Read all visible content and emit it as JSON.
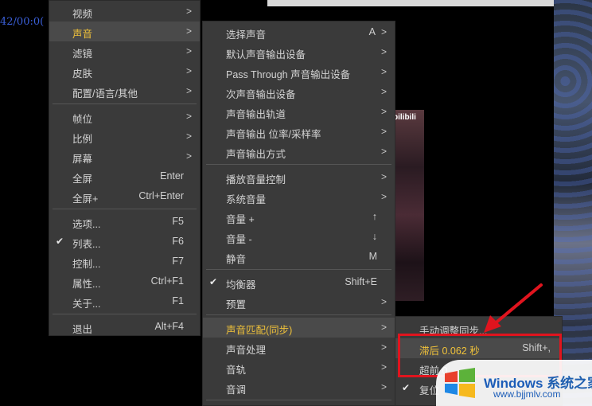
{
  "player": {
    "timecode": "42/00:0("
  },
  "thumbnail_logo": "bilibili",
  "menu1": [
    {
      "label": "视频",
      "shortcut": "",
      "arrow": ">",
      "check": ""
    },
    {
      "label": "声音",
      "shortcut": "",
      "arrow": ">",
      "check": "",
      "highlighted": true
    },
    {
      "label": "滤镜",
      "shortcut": "",
      "arrow": ">",
      "check": ""
    },
    {
      "label": "皮肤",
      "shortcut": "",
      "arrow": ">",
      "check": ""
    },
    {
      "label": "配置/语言/其他",
      "shortcut": "",
      "arrow": ">",
      "check": ""
    },
    {
      "label": "帧位",
      "shortcut": "",
      "arrow": ">",
      "check": ""
    },
    {
      "label": "比例",
      "shortcut": "",
      "arrow": ">",
      "check": ""
    },
    {
      "label": "屏幕",
      "shortcut": "",
      "arrow": ">",
      "check": ""
    },
    {
      "label": "全屏",
      "shortcut": "Enter",
      "arrow": "",
      "check": ""
    },
    {
      "label": "全屏+",
      "shortcut": "Ctrl+Enter",
      "arrow": "",
      "check": ""
    },
    {
      "label": "选项...",
      "shortcut": "F5",
      "arrow": "",
      "check": ""
    },
    {
      "label": "列表...",
      "shortcut": "F6",
      "arrow": "",
      "check": "✔"
    },
    {
      "label": "控制...",
      "shortcut": "F7",
      "arrow": "",
      "check": ""
    },
    {
      "label": "属性...",
      "shortcut": "Ctrl+F1",
      "arrow": "",
      "check": ""
    },
    {
      "label": "关于...",
      "shortcut": "F1",
      "arrow": "",
      "check": ""
    },
    {
      "label": "退出",
      "shortcut": "Alt+F4",
      "arrow": "",
      "check": ""
    }
  ],
  "menu2": [
    {
      "label": "选择声音",
      "shortcut": "A",
      "arrow": ">",
      "check": ""
    },
    {
      "label": "默认声音输出设备",
      "shortcut": "",
      "arrow": ">",
      "check": ""
    },
    {
      "label": "Pass Through 声音输出设备",
      "shortcut": "",
      "arrow": ">",
      "check": ""
    },
    {
      "label": "次声音输出设备",
      "shortcut": "",
      "arrow": ">",
      "check": ""
    },
    {
      "label": "声音输出轨道",
      "shortcut": "",
      "arrow": ">",
      "check": ""
    },
    {
      "label": "声音输出 位率/采样率",
      "shortcut": "",
      "arrow": ">",
      "check": ""
    },
    {
      "label": "声音输出方式",
      "shortcut": "",
      "arrow": ">",
      "check": ""
    },
    {
      "label": "播放音量控制",
      "shortcut": "",
      "arrow": ">",
      "check": ""
    },
    {
      "label": "系统音量",
      "shortcut": "",
      "arrow": ">",
      "check": ""
    },
    {
      "label": "音量 +",
      "shortcut": "↑",
      "arrow": "",
      "check": ""
    },
    {
      "label": "音量 -",
      "shortcut": "↓",
      "arrow": "",
      "check": ""
    },
    {
      "label": "静音",
      "shortcut": "M",
      "arrow": "",
      "check": ""
    },
    {
      "label": "均衡器",
      "shortcut": "Shift+E",
      "arrow": "",
      "check": "✔"
    },
    {
      "label": "预置",
      "shortcut": "",
      "arrow": ">",
      "check": ""
    },
    {
      "label": "声音匹配(同步)",
      "shortcut": "",
      "arrow": ">",
      "check": "",
      "highlighted": true
    },
    {
      "label": "声音处理",
      "shortcut": "",
      "arrow": ">",
      "check": ""
    },
    {
      "label": "音轨",
      "shortcut": "",
      "arrow": ">",
      "check": ""
    },
    {
      "label": "音调",
      "shortcut": "",
      "arrow": ">",
      "check": ""
    }
  ],
  "menu3": [
    {
      "label": "手动调整同步...",
      "shortcut": "",
      "check": ""
    },
    {
      "label": "滞后 0.062 秒",
      "shortcut": "Shift+,",
      "check": "",
      "highlighted": true
    },
    {
      "label": "超前 0",
      "shortcut": "",
      "check": ""
    },
    {
      "label": "复位",
      "shortcut": "",
      "check": "✔"
    }
  ],
  "watermark": {
    "brand": "Windows",
    "brand_suffix": "系统之家",
    "url": "www.bjjmlv.com"
  },
  "colors": {
    "menu_bg": "#3a3a3a",
    "highlight_text": "#f0c23a",
    "annotation_red": "#e0141e"
  }
}
